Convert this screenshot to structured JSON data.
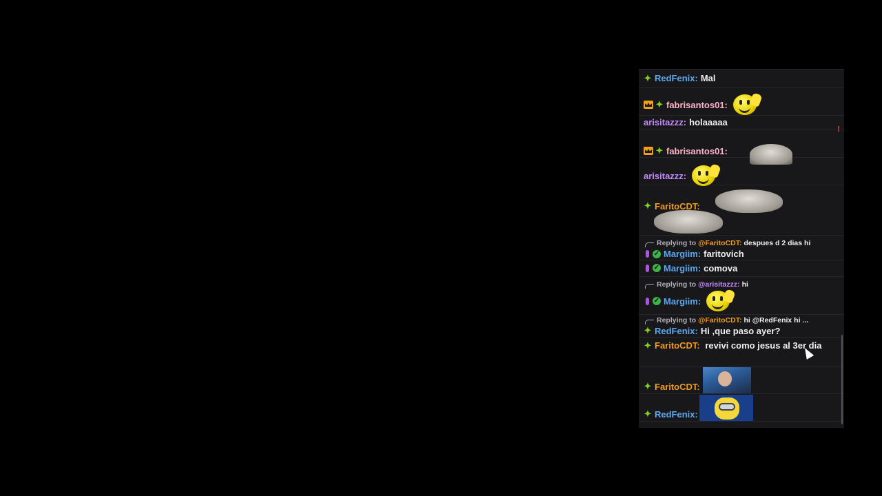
{
  "colors": {
    "page_bg": "#000000",
    "chat_bg": "#18181b",
    "redfenix": "#5aa7f0",
    "fabrisantos01": "#ffb3c8",
    "arisitazzz": "#c78bff",
    "faritocdt": "#f29a1a",
    "margiim": "#5aa7f0",
    "reply_text": "#adadb8"
  },
  "icons": {
    "star": "green-star-badge-icon",
    "crown": "crown-badge-icon",
    "mic": "microphone-badge-icon",
    "verified": "verified-badge-icon"
  },
  "chat": {
    "messages": [
      {
        "user": "RedFenix:",
        "text": "Mal"
      },
      {
        "user": "fabrisantos01:",
        "emote": "smiley-wave-emote"
      },
      {
        "user": "arisitazzz:",
        "text": "holaaaaa"
      },
      {
        "user": "fabrisantos01:",
        "emote": "bird-emote"
      },
      {
        "user": "arisitazzz:",
        "emote": "smiley-wave-emote"
      },
      {
        "user": "FaritoCDT:",
        "emote": "cat-emote"
      },
      {
        "reply_label": "Replying to",
        "reply_mention": "@FaritoCDT:",
        "reply_text": "despues d 2 dias hi",
        "user": "Margiim:",
        "text": "faritovich"
      },
      {
        "user": "Margiim:",
        "text": "comova"
      },
      {
        "reply_label": "Replying to",
        "reply_mention": "@arisitazzz:",
        "reply_text": "hi",
        "user": "Margiim:",
        "emote": "smiley-wave-emote"
      },
      {
        "reply_label": "Replying to",
        "reply_mention": "@FaritoCDT:",
        "reply_text": "hi @RedFenix hi ...",
        "user": "RedFenix:",
        "text": "Hi ,que paso ayer?"
      },
      {
        "user": "FaritoCDT:",
        "text": "revivi como jesus al 3er dia"
      },
      {
        "user": "FaritoCDT:",
        "emote": "photo-emote"
      },
      {
        "user": "RedFenix:",
        "emote": "minion-emote"
      }
    ]
  }
}
